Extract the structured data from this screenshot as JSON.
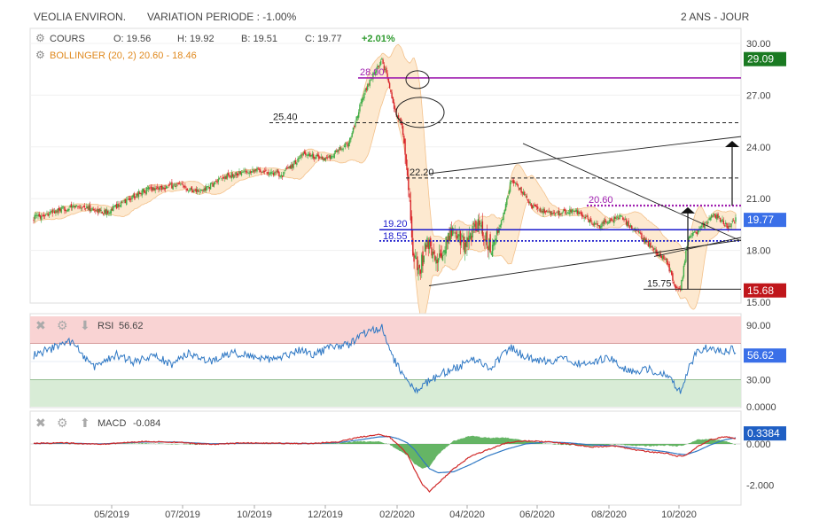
{
  "header": {
    "name": "VEOLIA ENVIRON.",
    "variation": "VARIATION PERIODE : -1.00%",
    "period": "2 ANS - JOUR"
  },
  "legend": {
    "cours_label": "COURS",
    "open": "O: 19.56",
    "high": "H: 19.92",
    "low": "B: 19.51",
    "close": "C: 19.77",
    "change": "+2.01%",
    "bollinger": "BOLLINGER (20, 2) 20.60 - 18.46"
  },
  "colors": {
    "candle_up": "#3fae49",
    "candle_down": "#d8262b",
    "bollinger_fill": "#fde9d0",
    "bollinger_line": "#f3c18b",
    "purple": "#a020b0",
    "blue": "#1a1acc",
    "rsi_line": "#2f78c4",
    "macd_line": "#d02828",
    "signal_line": "#2f78c4",
    "hist": "#4aa84a"
  },
  "price_panel": {
    "y_ticks": [
      "30.00",
      "27.00",
      "24.00",
      "21.00",
      "18.00",
      "15.00"
    ],
    "last_price_tag": "19.77",
    "high_tag": "29.09",
    "low_tag": "15.68",
    "levels": [
      {
        "label": "28.00"
      },
      {
        "label": "25.40"
      },
      {
        "label": "22.20"
      },
      {
        "label": "20.60"
      },
      {
        "label": "19.20"
      },
      {
        "label": "18.55"
      },
      {
        "label": "15.75"
      }
    ]
  },
  "rsi_panel": {
    "title": "RSI",
    "value": "56.62",
    "y_ticks": [
      "90.00",
      "30.00",
      "0.0000"
    ],
    "tag": "56.62"
  },
  "macd_panel": {
    "title": "MACD",
    "value": "-0.084",
    "y_ticks": [
      "0.000",
      "-2.000"
    ],
    "tag": "0.3384"
  },
  "x_ticks": [
    "05/2019",
    "07/2019",
    "10/2019",
    "12/2019",
    "02/2020",
    "04/2020",
    "06/2020",
    "08/2020",
    "10/2020"
  ],
  "chart_data": {
    "type": "line",
    "x": [
      "05/2019",
      "07/2019",
      "10/2019",
      "12/2019",
      "02/2020",
      "04/2020",
      "06/2020",
      "08/2020",
      "10/2020"
    ],
    "series": [],
    "price_anchors": [
      [
        0,
        19.9
      ],
      [
        40,
        20.6
      ],
      [
        65,
        20.2
      ],
      [
        100,
        21.5
      ],
      [
        130,
        21.8
      ],
      [
        150,
        21.4
      ],
      [
        175,
        22.3
      ],
      [
        200,
        22.7
      ],
      [
        225,
        22.4
      ],
      [
        245,
        23.6
      ],
      [
        265,
        23.3
      ],
      [
        285,
        24.2
      ],
      [
        298,
        27.0
      ],
      [
        308,
        28.3
      ],
      [
        315,
        29.0
      ],
      [
        322,
        27.5
      ],
      [
        328,
        25.8
      ],
      [
        333,
        25.3
      ],
      [
        338,
        22.5
      ],
      [
        343,
        18.0
      ],
      [
        348,
        16.6
      ],
      [
        356,
        18.5
      ],
      [
        366,
        17.3
      ],
      [
        378,
        19.2
      ],
      [
        390,
        18.4
      ],
      [
        402,
        19.5
      ],
      [
        414,
        18.0
      ],
      [
        424,
        19.8
      ],
      [
        432,
        22.1
      ],
      [
        440,
        21.5
      ],
      [
        452,
        20.5
      ],
      [
        470,
        20.1
      ],
      [
        490,
        20.3
      ],
      [
        510,
        19.4
      ],
      [
        530,
        20.0
      ],
      [
        545,
        19.1
      ],
      [
        560,
        18.1
      ],
      [
        572,
        17.4
      ],
      [
        580,
        16.0
      ],
      [
        585,
        15.7
      ],
      [
        592,
        18.8
      ],
      [
        600,
        19.1
      ],
      [
        615,
        20.1
      ],
      [
        628,
        19.4
      ],
      [
        635,
        19.8
      ]
    ],
    "rsi_anchors": [
      [
        0,
        57
      ],
      [
        20,
        66
      ],
      [
        35,
        73
      ],
      [
        45,
        55
      ],
      [
        55,
        44
      ],
      [
        75,
        58
      ],
      [
        90,
        49
      ],
      [
        110,
        56
      ],
      [
        125,
        47
      ],
      [
        140,
        59
      ],
      [
        160,
        50
      ],
      [
        180,
        60
      ],
      [
        200,
        55
      ],
      [
        220,
        52
      ],
      [
        240,
        62
      ],
      [
        255,
        58
      ],
      [
        270,
        66
      ],
      [
        285,
        69
      ],
      [
        298,
        80
      ],
      [
        308,
        85
      ],
      [
        315,
        87
      ],
      [
        320,
        70
      ],
      [
        326,
        52
      ],
      [
        332,
        40
      ],
      [
        338,
        33
      ],
      [
        344,
        17
      ],
      [
        350,
        22
      ],
      [
        360,
        30
      ],
      [
        372,
        38
      ],
      [
        385,
        45
      ],
      [
        400,
        52
      ],
      [
        412,
        41
      ],
      [
        424,
        57
      ],
      [
        432,
        65
      ],
      [
        445,
        55
      ],
      [
        460,
        50
      ],
      [
        480,
        52
      ],
      [
        500,
        47
      ],
      [
        520,
        55
      ],
      [
        540,
        38
      ],
      [
        555,
        42
      ],
      [
        570,
        37
      ],
      [
        580,
        25
      ],
      [
        585,
        18
      ],
      [
        592,
        40
      ],
      [
        600,
        62
      ],
      [
        612,
        66
      ],
      [
        625,
        60
      ],
      [
        632,
        64
      ],
      [
        635,
        56
      ]
    ],
    "macd_anchors": [
      [
        0,
        0.03
      ],
      [
        30,
        0.05
      ],
      [
        60,
        -0.02
      ],
      [
        100,
        0.12
      ],
      [
        130,
        0.08
      ],
      [
        160,
        -0.02
      ],
      [
        190,
        0.05
      ],
      [
        220,
        0.03
      ],
      [
        250,
        0.02
      ],
      [
        275,
        0.1
      ],
      [
        295,
        0.33
      ],
      [
        312,
        0.45
      ],
      [
        322,
        0.33
      ],
      [
        330,
        -0.05
      ],
      [
        338,
        -0.5
      ],
      [
        345,
        -1.3
      ],
      [
        352,
        -2.0
      ],
      [
        358,
        -2.3
      ],
      [
        366,
        -1.9
      ],
      [
        380,
        -1.2
      ],
      [
        395,
        -0.6
      ],
      [
        410,
        -0.3
      ],
      [
        428,
        0.05
      ],
      [
        445,
        0.15
      ],
      [
        465,
        0.1
      ],
      [
        485,
        0.0
      ],
      [
        505,
        -0.15
      ],
      [
        525,
        -0.1
      ],
      [
        545,
        -0.3
      ],
      [
        560,
        -0.4
      ],
      [
        572,
        -0.45
      ],
      [
        582,
        -0.6
      ],
      [
        590,
        -0.55
      ],
      [
        600,
        -0.15
      ],
      [
        612,
        0.2
      ],
      [
        625,
        0.35
      ],
      [
        632,
        0.3
      ],
      [
        635,
        0.25
      ]
    ],
    "signal_anchors": [
      [
        0,
        0.02
      ],
      [
        30,
        0.04
      ],
      [
        60,
        0.0
      ],
      [
        100,
        0.09
      ],
      [
        130,
        0.09
      ],
      [
        160,
        0.01
      ],
      [
        190,
        0.03
      ],
      [
        220,
        0.03
      ],
      [
        250,
        0.02
      ],
      [
        275,
        0.06
      ],
      [
        295,
        0.2
      ],
      [
        312,
        0.34
      ],
      [
        322,
        0.36
      ],
      [
        330,
        0.25
      ],
      [
        338,
        0.05
      ],
      [
        345,
        -0.3
      ],
      [
        352,
        -0.8
      ],
      [
        358,
        -1.2
      ],
      [
        366,
        -1.4
      ],
      [
        380,
        -1.35
      ],
      [
        395,
        -1.0
      ],
      [
        410,
        -0.6
      ],
      [
        428,
        -0.25
      ],
      [
        445,
        0.0
      ],
      [
        465,
        0.1
      ],
      [
        485,
        0.05
      ],
      [
        505,
        -0.05
      ],
      [
        525,
        -0.08
      ],
      [
        545,
        -0.2
      ],
      [
        560,
        -0.3
      ],
      [
        572,
        -0.38
      ],
      [
        582,
        -0.48
      ],
      [
        590,
        -0.52
      ],
      [
        600,
        -0.35
      ],
      [
        612,
        -0.05
      ],
      [
        625,
        0.2
      ],
      [
        632,
        0.27
      ],
      [
        635,
        0.3
      ]
    ]
  }
}
